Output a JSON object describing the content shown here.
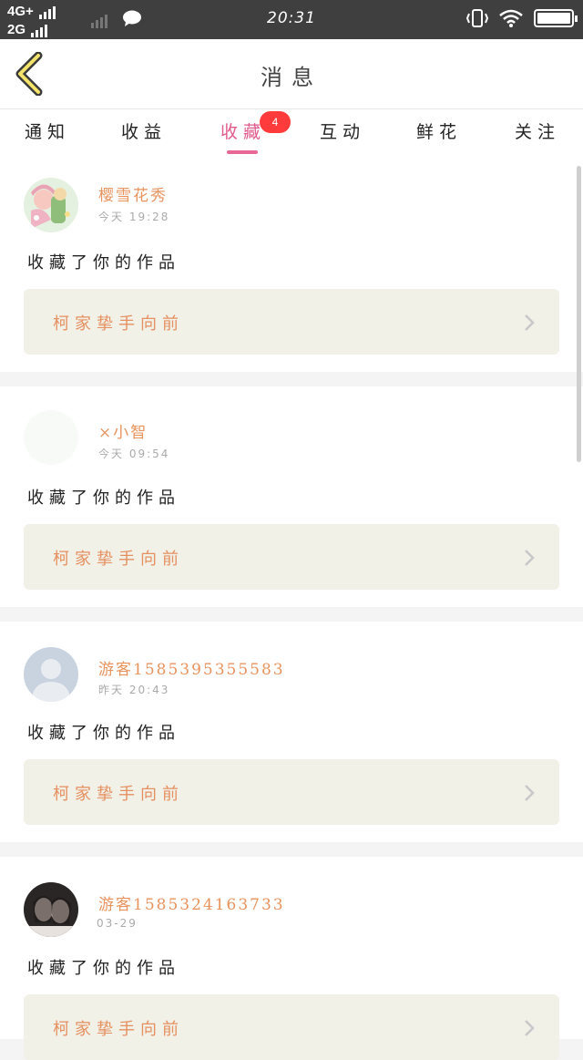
{
  "status_bar": {
    "network1": "4G+",
    "network2": "2G",
    "time": "20:31"
  },
  "header": {
    "title": "消息",
    "back_icon": "chevron-left-icon"
  },
  "tabs": [
    {
      "label": "通知"
    },
    {
      "label": "收益"
    },
    {
      "label": "收藏",
      "active": true,
      "badge": "4"
    },
    {
      "label": "互动"
    },
    {
      "label": "鲜花"
    },
    {
      "label": "关注"
    }
  ],
  "messages": [
    {
      "user": "樱雪花秀",
      "time": "今天 19:28",
      "action": "收藏了你的作品",
      "work": "柯家挚手向前",
      "avatar": "anime-avatar"
    },
    {
      "user": "×小智",
      "time": "今天 09:54",
      "action": "收藏了你的作品",
      "work": "柯家挚手向前",
      "avatar": "blank-avatar"
    },
    {
      "user": "游客1585395355583",
      "time": "昨天 20:43",
      "action": "收藏了你的作品",
      "work": "柯家挚手向前",
      "avatar": "default-user-avatar"
    },
    {
      "user": "游客1585324163733",
      "time": "03-29",
      "action": "收藏了你的作品",
      "work": "柯家挚手向前",
      "avatar": "photo-avatar"
    }
  ],
  "colors": {
    "accent": "#e05a8c",
    "username": "#e8935e",
    "badge": "#ff3b3b",
    "work_bg": "#f1f1e8"
  }
}
